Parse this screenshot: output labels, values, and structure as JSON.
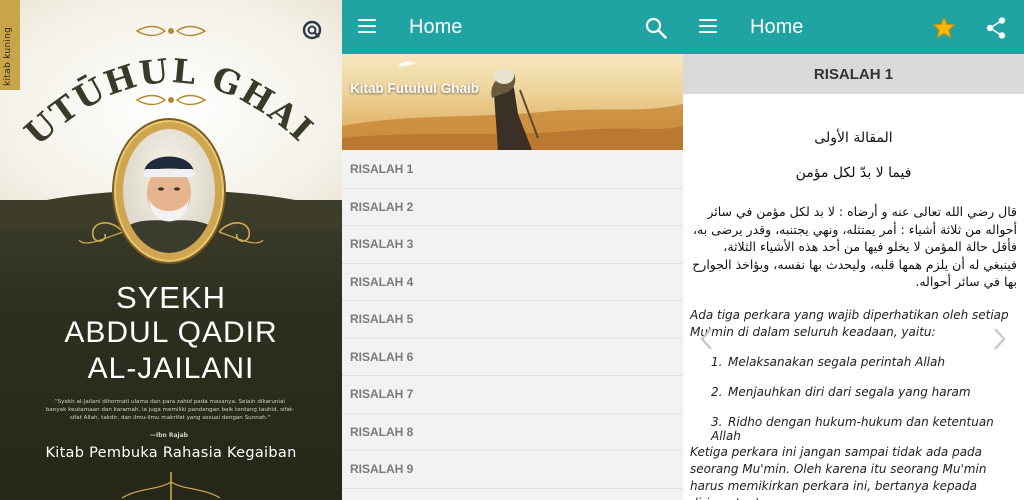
{
  "cover": {
    "spine_label": "kitab kuning",
    "title": "FUTŪHUL GHAIB",
    "author_line1": "SYEKH",
    "author_line2": "ABDUL QADIR",
    "author_line3": "AL-JAILANI",
    "quote": "\"Syekh al-Jailani dihormati ulama dan para zahid pada masanya. Selain dikaruniai banyak keutamaan dan karamah, ia juga memiliki pandangan baik tentang tauhid, sifat-sifat Allah, takdir, dan ilmu-ilmu makrifat yang sesuai dengan Sunnah.\"",
    "quote_author": "—Ibn Rajab",
    "subtitle": "Kitab Pembuka Rahasia Kegaiban"
  },
  "list_screen": {
    "title": "Home",
    "banner_title": "Kitab Futuhul Ghaib",
    "items": [
      "RISALAH 1",
      "RISALAH 2",
      "RISALAH 3",
      "RISALAH 4",
      "RISALAH 5",
      "RISALAH 6",
      "RISALAH 7",
      "RISALAH 8",
      "RISALAH 9"
    ]
  },
  "reader_screen": {
    "title": "Home",
    "section": "RISALAH 1",
    "arabic_title": "المقالة الأولى",
    "arabic_subtitle": "فيما لا بدّ لكل مؤمن",
    "arabic_body": "قال رضي الله تعالى عنه و أرضاه : لا بد لكل مؤمن في سائر أحواله من ثلاثة أشياء : أمر يمتثله، ونهي يجتنبه، وقدر يرضى به، فأقل حالة المؤمن لا يخلو فيها من أحد هذه الأشياء الثلاثة، فينبغي له أن يلزم همها قلبه، وليحدث بها نفسه، ويؤاخذ الجوارح بها في سائر أحواله.",
    "intro": "Ada tiga perkara yang wajib diperhatikan oleh setiap Mu'min di dalam seluruh keadaan, yaitu:",
    "points": [
      {
        "num": "1.",
        "text": "Melaksanakan segala perintah Allah"
      },
      {
        "num": "2.",
        "text": "Menjauhkan diri dari segala yang haram"
      },
      {
        "num": "3.",
        "text": "Ridho dengan hukum-hukum dan ketentuan Allah"
      }
    ],
    "closing": "Ketiga perkara ini jangan sampai tidak ada pada seorang Mu'min. Oleh karena itu seorang Mu'min harus memikirkan perkara ini, bertanya kepada dirinya tentang"
  },
  "colors": {
    "app_bar": "#1fa3a3",
    "star": "#f5b800",
    "cover_dark": "#2f2f20",
    "gold": "#cfa54f"
  },
  "icons": [
    "menu-icon",
    "search-icon",
    "star-icon",
    "share-icon",
    "chevron-left-icon",
    "chevron-right-icon"
  ]
}
